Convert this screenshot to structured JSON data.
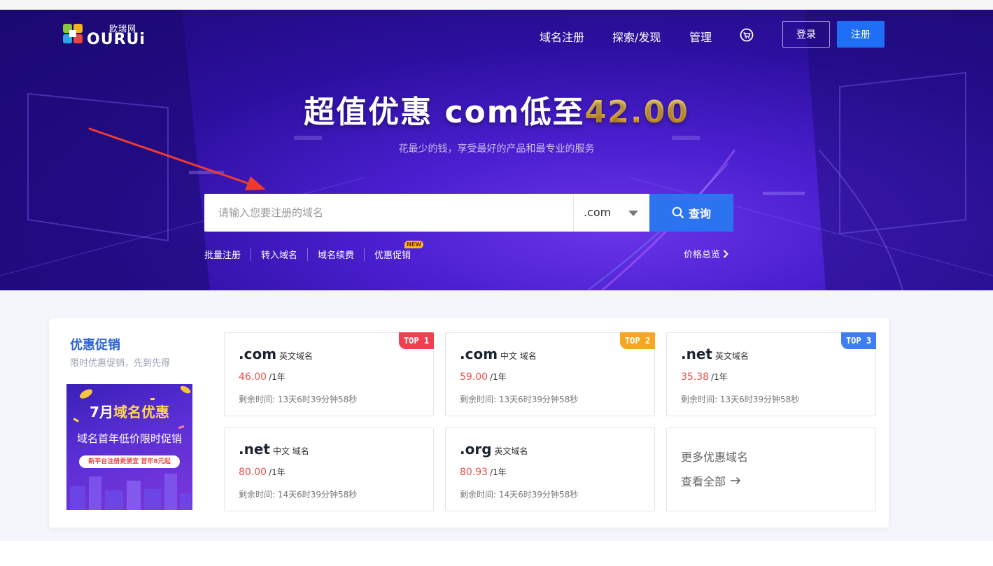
{
  "brand": {
    "cn": "欧瑞网",
    "en": "OURUi"
  },
  "nav": {
    "items": [
      "域名注册",
      "探索/发现",
      "管理"
    ],
    "login": "登录",
    "register": "注册"
  },
  "hero": {
    "headline_prefix": "超值优惠 com低至",
    "headline_price": "42.00",
    "subline": "花最少的钱，享受最好的产品和最专业的服务"
  },
  "search": {
    "placeholder": "请输入您要注册的域名",
    "tld": ".com",
    "button": "查询"
  },
  "quick_links": [
    "批量注册",
    "转入域名",
    "域名续费",
    "优惠促销"
  ],
  "new_badge": "NEW",
  "price_overview": "价格总览",
  "promo": {
    "title": "优惠促销",
    "subtitle": "限时优惠促销，先到先得",
    "banner": {
      "title_a": "7月",
      "title_b": "域名优惠",
      "subtitle": "域名首年低价限时促销",
      "pill": "新平台注册更便宜 首年8元起"
    },
    "cards": [
      {
        "tld": ".com",
        "kind": "英文域名",
        "price": "46.00",
        "unit": "/1年",
        "time": "剩余时间: 13天6时39分钟58秒",
        "rank": "TOP 1",
        "rank_color": "#f0404f"
      },
      {
        "tld": ".com",
        "kind": "中文 域名",
        "price": "59.00",
        "unit": "/1年",
        "time": "剩余时间: 13天6时39分钟58秒",
        "rank": "TOP 2",
        "rank_color": "#f5a623"
      },
      {
        "tld": ".net",
        "kind": "英文域名",
        "price": "35.38",
        "unit": "/1年",
        "time": "剩余时间: 13天6时39分钟58秒",
        "rank": "TOP 3",
        "rank_color": "#3f7ef0"
      },
      {
        "tld": ".net",
        "kind": "中文 域名",
        "price": "80.00",
        "unit": "/1年",
        "time": "剩余时间: 14天6时39分钟58秒"
      },
      {
        "tld": ".org",
        "kind": "英文域名",
        "price": "80.93",
        "unit": "/1年",
        "time": "剩余时间: 14天6时39分钟58秒"
      }
    ],
    "more": {
      "title": "更多优惠域名",
      "link": "查看全部"
    }
  },
  "colors": {
    "accent": "#2c73ef",
    "price": "#e8524a",
    "title": "#2f64d6",
    "annotation_arrow": "#f03a2f"
  }
}
